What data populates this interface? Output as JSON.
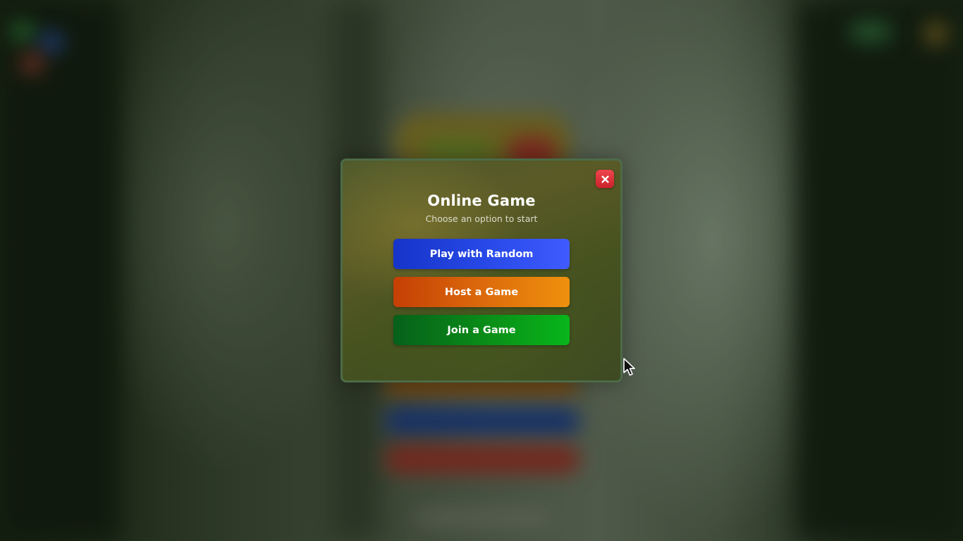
{
  "modal": {
    "title": "Online Game",
    "subtitle": "Choose an option to start",
    "close_icon": "close-icon",
    "buttons": [
      {
        "label": "Play with Random",
        "color_start": "#1634c8",
        "color_end": "#3f5bff"
      },
      {
        "label": "Host a Game",
        "color_start": "#c43f04",
        "color_end": "#ef910d"
      },
      {
        "label": "Join a Game",
        "color_start": "#06601a",
        "color_end": "#08b61a"
      }
    ]
  },
  "colors": {
    "close_button": "#e5343c",
    "modal_border": "#4d6b48",
    "text": "#ffffff"
  }
}
